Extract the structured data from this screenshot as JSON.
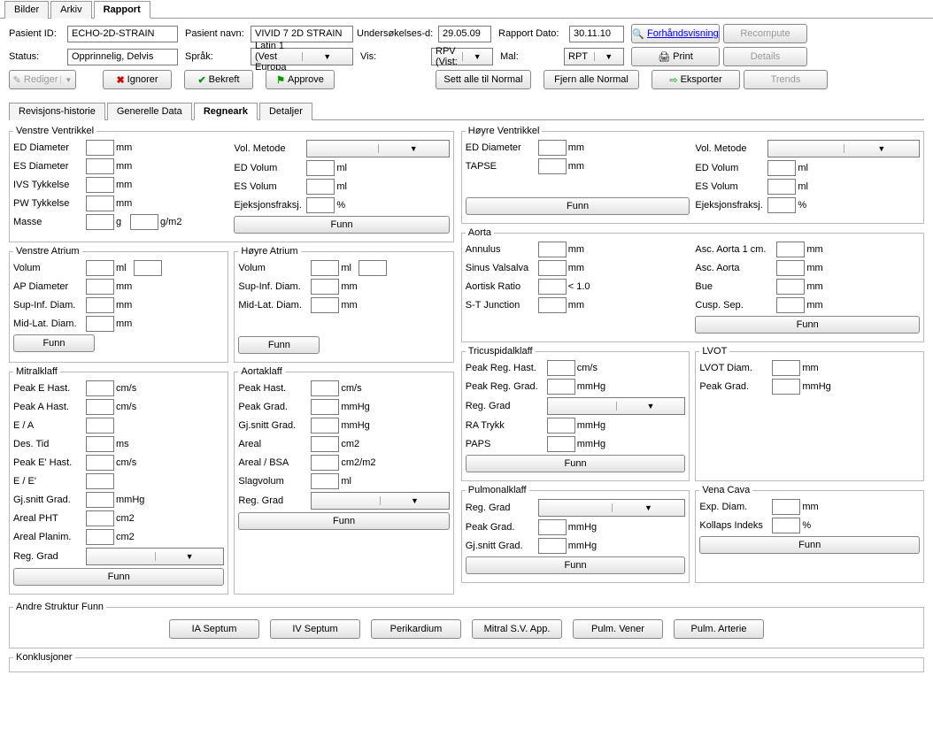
{
  "main_tabs": {
    "bilder": "Bilder",
    "arkiv": "Arkiv",
    "rapport": "Rapport"
  },
  "hdr": {
    "pasient_id_lbl": "Pasient ID:",
    "pasient_id": "ECHO-2D-STRAIN",
    "pasient_navn_lbl": "Pasient navn:",
    "pasient_navn": "VIVID 7 2D STRAIN",
    "unders_lbl": "Undersøkelses-d:",
    "unders": "29.05.09",
    "rapport_dato_lbl": "Rapport Dato:",
    "rapport_dato": "30.11.10",
    "status_lbl": "Status:",
    "status": "Opprinnelig, Delvis",
    "sprak_lbl": "Språk:",
    "sprak": "Latin 1 (Vest Europa",
    "vis_lbl": "Vis:",
    "vis": "RPV (Vist:",
    "mal_lbl": "Mal:",
    "mal": "RPT"
  },
  "btns": {
    "forhands": "Forhåndsvisning",
    "recompute": "Recompute",
    "print": "Print",
    "details": "Details",
    "rediger": "Rediger",
    "ignorer": "Ignorer",
    "bekreft": "Bekreft",
    "approve": "Approve",
    "sett_normal": "Sett alle til Normal",
    "fjern_normal": "Fjern alle Normal",
    "eksporter": "Eksporter",
    "trends": "Trends"
  },
  "sub_tabs": {
    "rev": "Revisjons-historie",
    "gen": "Generelle Data",
    "regn": "Regneark",
    "det": "Detaljer"
  },
  "sec": {
    "vv": "Venstre Ventrikkel",
    "va": "Venstre Atrium",
    "ha": "Høyre Atrium",
    "mk": "Mitralklaff",
    "ak": "Aortaklaff",
    "hv": "Høyre Ventrikkel",
    "aorta": "Aorta",
    "tk": "Tricuspidalklaff",
    "lvot": "LVOT",
    "pk": "Pulmonalklaff",
    "vc": "Vena Cava",
    "asf": "Andre Struktur Funn",
    "konkl": "Konklusjoner"
  },
  "f": {
    "ed_dia": "ED Diameter",
    "es_dia": "ES Diameter",
    "ivs": "IVS Tykkelse",
    "pw": "PW Tykkelse",
    "masse": "Masse",
    "vol_met": "Vol. Metode",
    "ed_vol": "ED Volum",
    "es_vol": "ES Volum",
    "ef": "Ejeksjonsfraksj.",
    "funn": "Funn",
    "volum": "Volum",
    "ap_dia": "AP Diameter",
    "sup_inf": "Sup-Inf. Diam.",
    "mid_lat": "Mid-Lat. Diam.",
    "peak_e": "Peak E Hast.",
    "peak_a": "Peak A Hast.",
    "ea": "E / A",
    "des_tid": "Des. Tid",
    "peak_ep": "Peak E' Hast.",
    "eep": "E / E'",
    "gj_grad": "Gj.snitt Grad.",
    "areal_pht": "Areal PHT",
    "areal_plan": "Areal Planim.",
    "reg_grad": "Reg. Grad",
    "peak_hast": "Peak Hast.",
    "peak_grad": "Peak Grad.",
    "areal": "Areal",
    "areal_bsa": "Areal / BSA",
    "slagvol": "Slagvolum",
    "tapse": "TAPSE",
    "annulus": "Annulus",
    "sinus": "Sinus Valsalva",
    "aort_ratio": "Aortisk Ratio",
    "st_junc": "S-T Junction",
    "asc_aorta_1": "Asc. Aorta 1 cm.",
    "asc_aorta": "Asc. Aorta",
    "bue": "Bue",
    "cusp_sep": "Cusp. Sep.",
    "peak_reg_hast": "Peak Reg. Hast.",
    "peak_reg_grad": "Peak Reg. Grad.",
    "ra_trykk": "RA Trykk",
    "paps": "PAPS",
    "lvot_diam": "LVOT Diam.",
    "exp_diam": "Exp. Diam.",
    "kollaps": "Kollaps Indeks",
    "lt10": "< 1.0"
  },
  "u": {
    "mm": "mm",
    "ml": "ml",
    "g": "g",
    "gm2": "g/m2",
    "pct": "%",
    "cms": "cm/s",
    "ms": "ms",
    "mmhg": "mmHg",
    "cm2": "cm2",
    "cm2m2": "cm2/m2"
  },
  "struct_btns": {
    "ia": "IA Septum",
    "iv": "IV Septum",
    "peri": "Perikardium",
    "mitral": "Mitral S.V. App.",
    "pulm_v": "Pulm. Vener",
    "pulm_a": "Pulm. Arterie"
  }
}
